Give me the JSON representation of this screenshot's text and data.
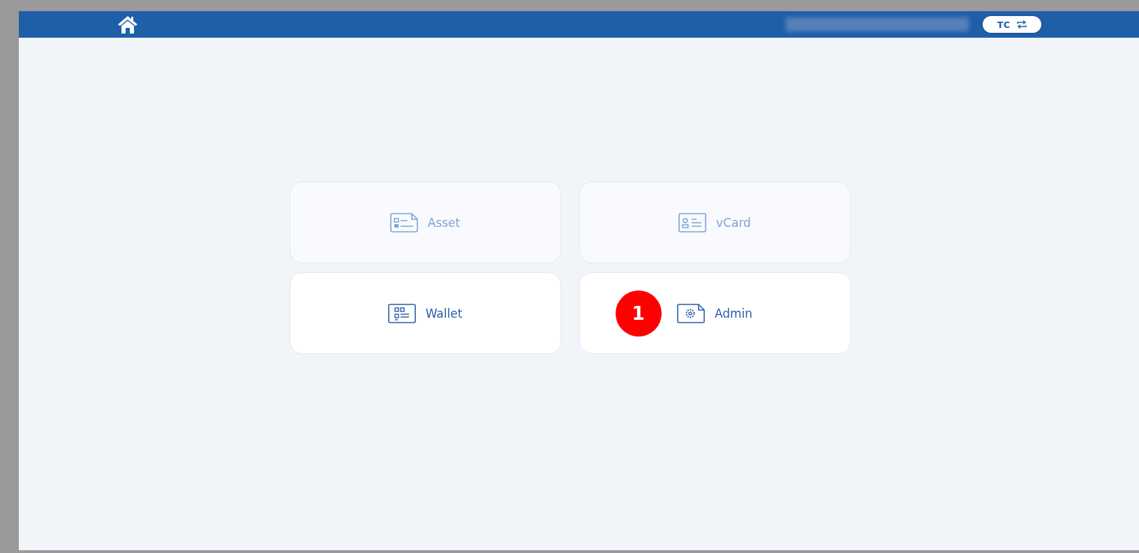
{
  "header": {
    "user_button": "TC"
  },
  "tiles": [
    {
      "label": "Asset",
      "kind": "asset",
      "disabled": true
    },
    {
      "label": "vCard",
      "kind": "vcard",
      "disabled": true
    },
    {
      "label": "Wallet",
      "kind": "wallet",
      "disabled": false
    },
    {
      "label": "Admin",
      "kind": "admin",
      "disabled": false,
      "badge": "1"
    }
  ]
}
